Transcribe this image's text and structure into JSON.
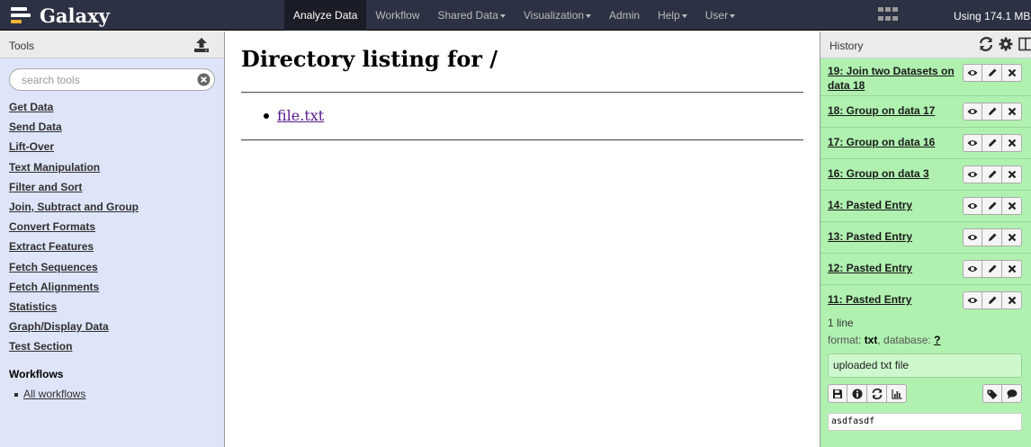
{
  "brand": {
    "title": "Galaxy"
  },
  "nav": {
    "items": [
      {
        "label": "Analyze Data",
        "active": true,
        "dropdown": false
      },
      {
        "label": "Workflow",
        "active": false,
        "dropdown": false
      },
      {
        "label": "Shared Data",
        "active": false,
        "dropdown": true
      },
      {
        "label": "Visualization",
        "active": false,
        "dropdown": true
      },
      {
        "label": "Admin",
        "active": false,
        "dropdown": false
      },
      {
        "label": "Help",
        "active": false,
        "dropdown": true
      },
      {
        "label": "User",
        "active": false,
        "dropdown": true
      }
    ],
    "quota": "Using 174.1 MB"
  },
  "tools": {
    "title": "Tools",
    "search_placeholder": "search tools",
    "sections": [
      "Get Data",
      "Send Data",
      "Lift-Over",
      "Text Manipulation",
      "Filter and Sort",
      "Join, Subtract and Group",
      "Convert Formats",
      "Extract Features",
      "Fetch Sequences",
      "Fetch Alignments",
      "Statistics",
      "Graph/Display Data",
      "Test Section"
    ],
    "workflows_title": "Workflows",
    "workflows_link": "All workflows"
  },
  "center": {
    "title": "Directory listing for /",
    "files": [
      "file.txt"
    ]
  },
  "history": {
    "title": "History",
    "datasets": [
      {
        "name": "19: Join two Datasets on data 18",
        "state": "ok"
      },
      {
        "name": "18: Group on data 17",
        "state": "ok"
      },
      {
        "name": "17: Group on data 16",
        "state": "ok"
      },
      {
        "name": "16: Group on data 3",
        "state": "ok"
      },
      {
        "name": "14: Pasted Entry",
        "state": "ok"
      },
      {
        "name": "13: Pasted Entry",
        "state": "ok"
      },
      {
        "name": "12: Pasted Entry",
        "state": "ok"
      },
      {
        "name": "11: Pasted Entry",
        "state": "ok",
        "expanded": true
      }
    ],
    "expanded": {
      "lines": "1 line",
      "format_label": "format: ",
      "format": "txt",
      "database_label": ", database: ",
      "database": "?",
      "info": "uploaded txt file",
      "peek": "asdfasdf"
    }
  },
  "colors": {
    "masthead": "#2c3143",
    "tool_panel": "#dfe5f9",
    "dataset_ok": "#b0f1b0"
  }
}
